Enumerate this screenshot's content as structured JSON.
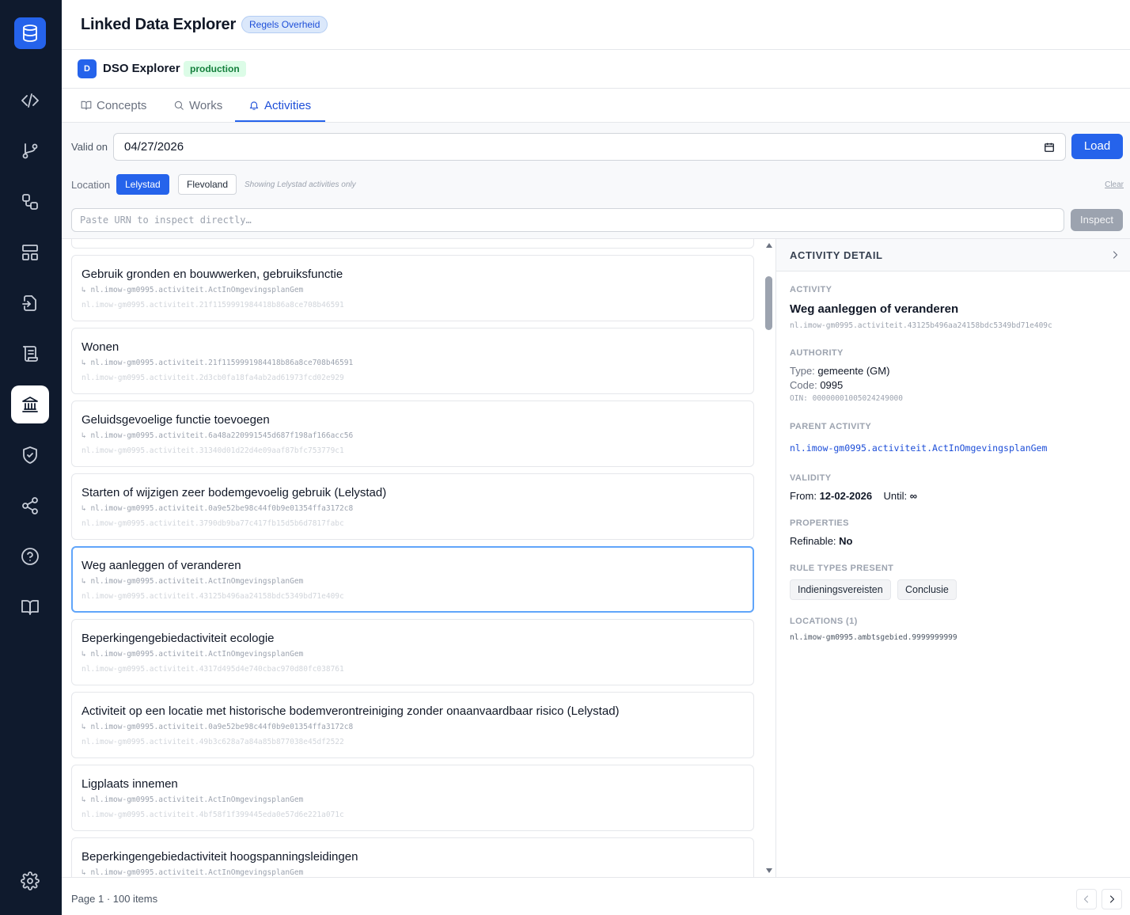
{
  "app": {
    "title": "Linked Data Explorer",
    "org_badge": "Regels Overheid"
  },
  "sidebar": {
    "logo_icon": "database-icon",
    "items": [
      {
        "icon": "code-icon"
      },
      {
        "icon": "git-branch-icon"
      },
      {
        "icon": "workflow-icon"
      },
      {
        "icon": "layout-icon"
      },
      {
        "icon": "import-icon"
      },
      {
        "icon": "scroll-icon"
      },
      {
        "icon": "landmark-icon",
        "active": true
      },
      {
        "icon": "shield-check-icon"
      },
      {
        "icon": "share-icon"
      },
      {
        "icon": "help-icon"
      },
      {
        "icon": "book-icon"
      }
    ],
    "settings_icon": "settings-icon"
  },
  "source": {
    "avatar": "D",
    "name": "DSO Explorer",
    "env": "production"
  },
  "tabs": [
    {
      "label": "Concepts",
      "icon": "book-open-icon"
    },
    {
      "label": "Works",
      "icon": "search-icon"
    },
    {
      "label": "Activities",
      "icon": "bell-icon",
      "active": true
    }
  ],
  "filters": {
    "valid_label": "Valid on",
    "date_value": "04/27/2026",
    "load_label": "Load",
    "location_label": "Location",
    "locations": [
      "Lelystad",
      "Flevoland"
    ],
    "selected_location": "Lelystad",
    "location_note": "Showing Lelystad activities only",
    "clear_label": "Clear",
    "urn_placeholder": "Paste URN to inspect directly…",
    "inspect_label": "Inspect"
  },
  "activities": [
    {
      "title": "Gebruik gronden en bouwwerken, gebruiksfunctie",
      "parent": "↳ nl.imow-gm0995.activiteit.ActInOmgevingsplanGem",
      "urn": "nl.imow-gm0995.activiteit.21f1159991984418b86a8ce708b46591"
    },
    {
      "title": "Wonen",
      "parent": "↳ nl.imow-gm0995.activiteit.21f1159991984418b86a8ce708b46591",
      "urn": "nl.imow-gm0995.activiteit.2d3cb0fa18fa4ab2ad61973fcd02e929"
    },
    {
      "title": "Geluidsgevoelige functie toevoegen",
      "parent": "↳ nl.imow-gm0995.activiteit.6a48a220991545d687f198af166acc56",
      "urn": "nl.imow-gm0995.activiteit.31340d01d22d4e09aaf87bfc753779c1"
    },
    {
      "title": "Starten of wijzigen zeer bodemgevoelig gebruik (Lelystad)",
      "parent": "↳ nl.imow-gm0995.activiteit.0a9e52be98c44f0b9e01354ffa3172c8",
      "urn": "nl.imow-gm0995.activiteit.3790db9ba77c417fb15d5b6d7817fabc"
    },
    {
      "title": "Weg aanleggen of veranderen",
      "parent": "↳ nl.imow-gm0995.activiteit.ActInOmgevingsplanGem",
      "urn": "nl.imow-gm0995.activiteit.43125b496aa24158bdc5349bd71e409c",
      "selected": true
    },
    {
      "title": "Beperkingengebiedactiviteit ecologie",
      "parent": "↳ nl.imow-gm0995.activiteit.ActInOmgevingsplanGem",
      "urn": "nl.imow-gm0995.activiteit.4317d495d4e740cbac970d80fc038761"
    },
    {
      "title": "Activiteit op een locatie met historische bodemverontreiniging zonder onaanvaardbaar risico (Lelystad)",
      "parent": "↳ nl.imow-gm0995.activiteit.0a9e52be98c44f0b9e01354ffa3172c8",
      "urn": "nl.imow-gm0995.activiteit.49b3c628a7a84a85b877038e45df2522"
    },
    {
      "title": "Ligplaats innemen",
      "parent": "↳ nl.imow-gm0995.activiteit.ActInOmgevingsplanGem",
      "urn": "nl.imow-gm0995.activiteit.4bf58f1f399445eda0e57d6e221a071c"
    },
    {
      "title": "Beperkingengebiedactiviteit hoogspanningsleidingen",
      "parent": "↳ nl.imow-gm0995.activiteit.ActInOmgevingsplanGem",
      "urn": ""
    }
  ],
  "detail": {
    "header": "ACTIVITY DETAIL",
    "activity_label": "ACTIVITY",
    "activity_name": "Weg aanleggen of veranderen",
    "activity_urn": "nl.imow-gm0995.activiteit.43125b496aa24158bdc5349bd71e409c",
    "authority_label": "AUTHORITY",
    "type_key": "Type:",
    "type_value": "gemeente (GM)",
    "code_key": "Code:",
    "code_value": "0995",
    "oin_text": "OIN: 00000001005024249000",
    "parent_label": "PARENT ACTIVITY",
    "parent_urn": "nl.imow-gm0995.activiteit.ActInOmgevingsplanGem",
    "validity_label": "VALIDITY",
    "from_key": "From:",
    "from_value": "12-02-2026",
    "until_key": "Until:",
    "until_value": "∞",
    "properties_label": "PROPERTIES",
    "refinable_key": "Refinable:",
    "refinable_value": "No",
    "rule_types_label": "RULE TYPES PRESENT",
    "rule_types": [
      "Indieningsvereisten",
      "Conclusie"
    ],
    "locations_label": "LOCATIONS (1)",
    "locations": [
      "nl.imow-gm0995.ambtsgebied.9999999999"
    ]
  },
  "footer": {
    "page_info": "Page 1 · 100 items"
  }
}
